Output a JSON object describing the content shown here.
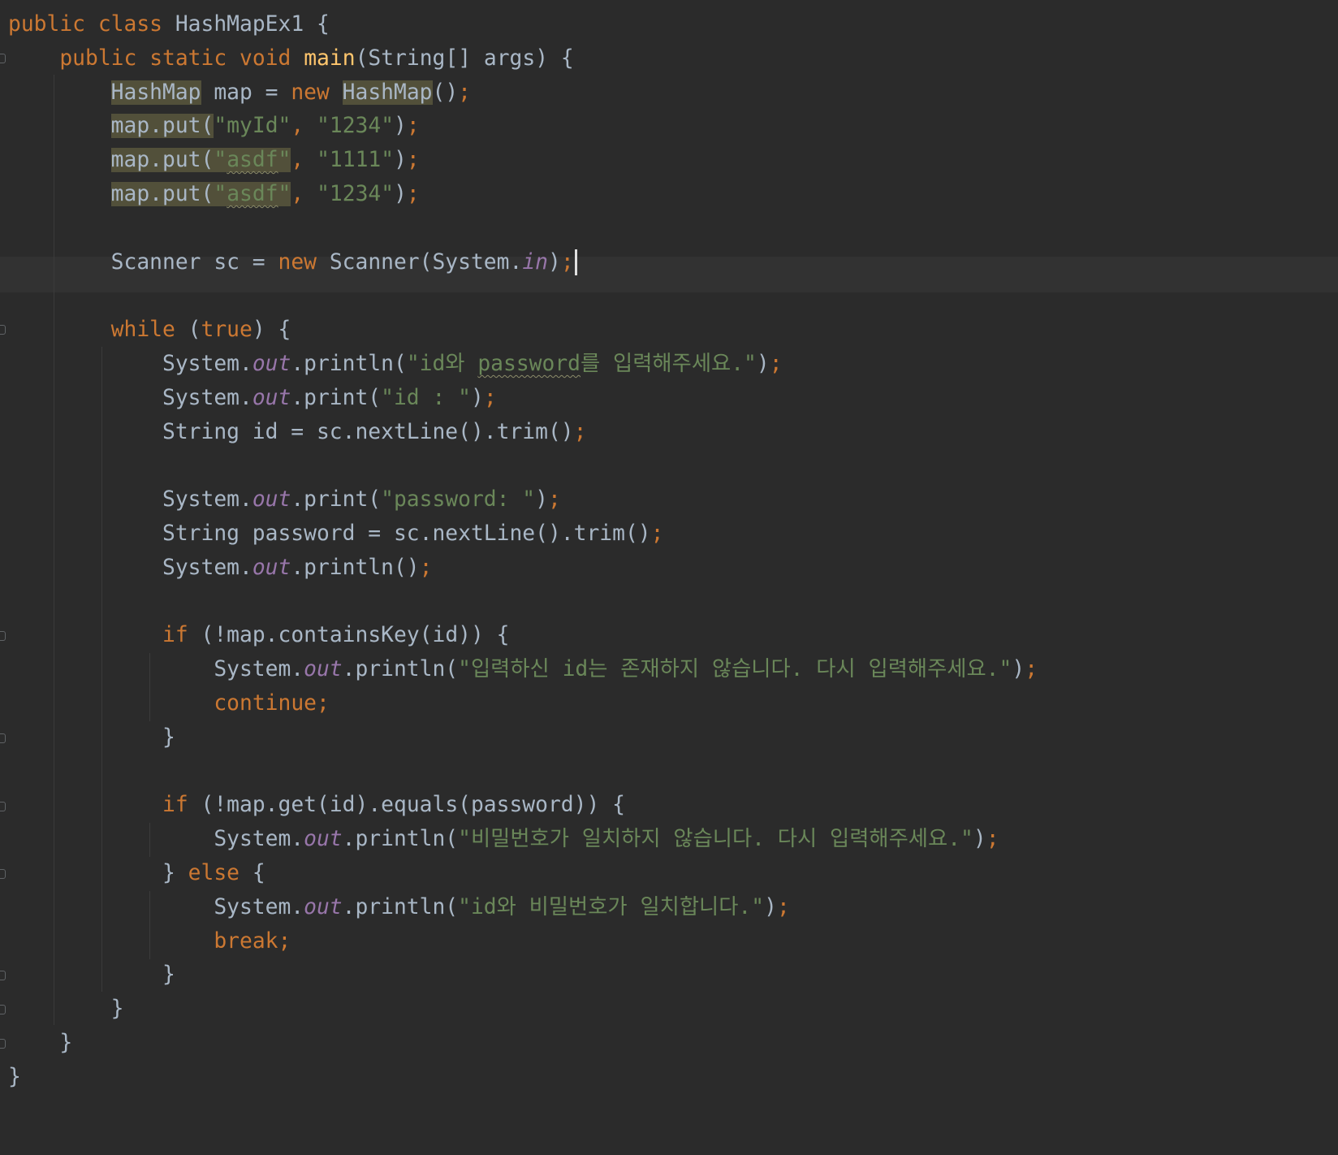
{
  "editor": {
    "language": "Java",
    "theme": "Darcula",
    "colors": {
      "background": "#2b2b2b",
      "keyword": "#cc7832",
      "method_declaration": "#ffc66d",
      "string": "#6a8759",
      "static_field": "#9876aa",
      "plain": "#a9b7c6",
      "identifier_highlight": "#52503a",
      "current_line": "#323232"
    },
    "caret_line_number": 8,
    "lines": [
      "public class HashMapEx1 {",
      "    public static void main(String[] args) {",
      "        HashMap map = new HashMap();",
      "        map.put(\"myId\", \"1234\");",
      "        map.put(\"asdf\", \"1111\");",
      "        map.put(\"asdf\", \"1234\");",
      "",
      "        Scanner sc = new Scanner(System.in);",
      "",
      "        while (true) {",
      "            System.out.println(\"id와 password를 입력해주세요.\");",
      "            System.out.print(\"id : \");",
      "            String id = sc.nextLine().trim();",
      "",
      "            System.out.print(\"password: \");",
      "            String password = sc.nextLine().trim();",
      "            System.out.println();",
      "",
      "            if (!map.containsKey(id)) {",
      "                System.out.println(\"입력하신 id는 존재하지 않습니다. 다시 입력해주세요.\");",
      "                continue;",
      "            }",
      "",
      "            if (!map.get(id).equals(password)) {",
      "                System.out.println(\"비밀번호가 일치하지 않습니다. 다시 입력해주세요.\");",
      "            } else {",
      "                System.out.println(\"id와 비밀번호가 일치합니다.\");",
      "                break;",
      "            }",
      "        }",
      "    }",
      "}"
    ]
  }
}
